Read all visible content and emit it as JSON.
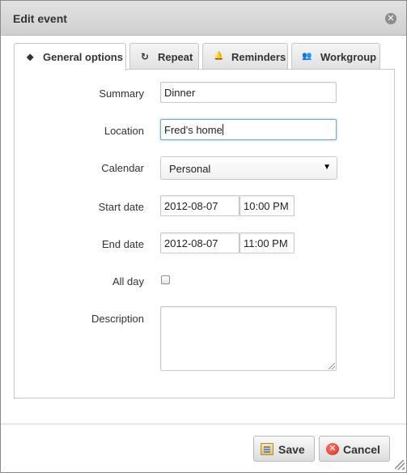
{
  "dialog": {
    "title": "Edit event",
    "close_glyph": "✕"
  },
  "tabs": [
    {
      "label": "General options",
      "icon": "tag-icon",
      "glyph": "⬥",
      "active": true
    },
    {
      "label": "Repeat",
      "icon": "refresh-icon",
      "glyph": "↻",
      "active": false
    },
    {
      "label": "Reminders",
      "icon": "bell-icon",
      "glyph": "🔔",
      "active": false
    },
    {
      "label": "Workgroup",
      "icon": "group-icon",
      "glyph": "👥",
      "active": false
    }
  ],
  "form": {
    "summary_label": "Summary",
    "summary_value": "Dinner",
    "location_label": "Location",
    "location_value": "Fred's home",
    "calendar_label": "Calendar",
    "calendar_value": "Personal",
    "calendar_arrow": "▼",
    "start_label": "Start date",
    "start_date": "2012-08-07",
    "start_time": "10:00 PM",
    "end_label": "End date",
    "end_date": "2012-08-07",
    "end_time": "11:00 PM",
    "allday_label": "All day",
    "allday_checked": false,
    "description_label": "Description",
    "description_value": ""
  },
  "buttons": {
    "save_label": "Save",
    "cancel_label": "Cancel",
    "cancel_glyph": "✕"
  },
  "colors": {
    "titlebar": "#d8d8d8",
    "focus": "#7aa7c7",
    "cancel_icon": "#d4281c"
  }
}
